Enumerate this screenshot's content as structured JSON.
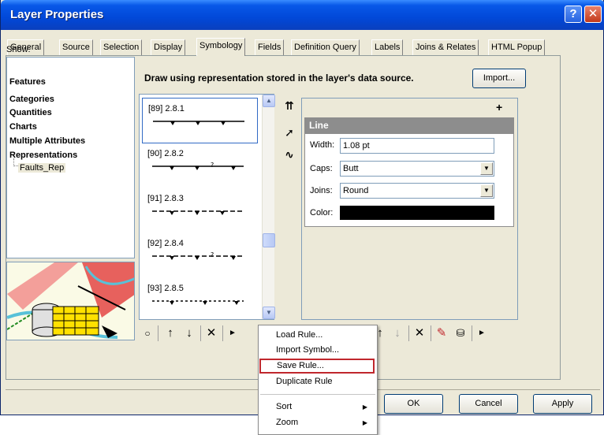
{
  "window": {
    "title": "Layer Properties",
    "help_glyph": "?",
    "close_glyph": "✕"
  },
  "tabs": [
    {
      "label": "General"
    },
    {
      "label": "Source"
    },
    {
      "label": "Selection"
    },
    {
      "label": "Display"
    },
    {
      "label": "Symbology"
    },
    {
      "label": "Fields"
    },
    {
      "label": "Definition Query"
    },
    {
      "label": "Labels"
    },
    {
      "label": "Joins & Relates"
    },
    {
      "label": "HTML Popup"
    }
  ],
  "show": {
    "label": "Show:",
    "items": [
      {
        "label": "Features"
      },
      {
        "label": "Categories"
      },
      {
        "label": "Quantities"
      },
      {
        "label": "Charts"
      },
      {
        "label": "Multiple Attributes"
      },
      {
        "label": "Representations"
      }
    ],
    "sub_item": "Faults_Rep"
  },
  "description": "Draw using representation stored in the layer's data source.",
  "import_label": "Import...",
  "rules": [
    {
      "label": "[89] 2.8.1"
    },
    {
      "label": "[90] 2.8.2"
    },
    {
      "label": "[91] 2.8.3"
    },
    {
      "label": "[92] 2.8.4"
    },
    {
      "label": "[93] 2.8.5"
    }
  ],
  "props": {
    "plus_glyph": "+",
    "header": "Line",
    "width_label": "Width:",
    "width_value": "1.08 pt",
    "caps_label": "Caps:",
    "caps_value": "Butt",
    "joins_label": "Joins:",
    "joins_value": "Round",
    "color_label": "Color:",
    "color_value": "#000000"
  },
  "context_menu": {
    "items": [
      {
        "label": "Load Rule..."
      },
      {
        "label": "Import Symbol..."
      },
      {
        "label": "Save Rule..."
      },
      {
        "label": "Duplicate Rule"
      },
      {
        "label": "Sort"
      },
      {
        "label": "Zoom"
      }
    ],
    "highlight_color": "#c0272d"
  },
  "buttons": {
    "ok": "OK",
    "cancel": "Cancel",
    "apply": "Apply"
  },
  "icons": {
    "move_up": "↑",
    "move_down": "↓",
    "delete": "✕",
    "more": "►",
    "add": "○",
    "help": "?",
    "close": "✕"
  }
}
